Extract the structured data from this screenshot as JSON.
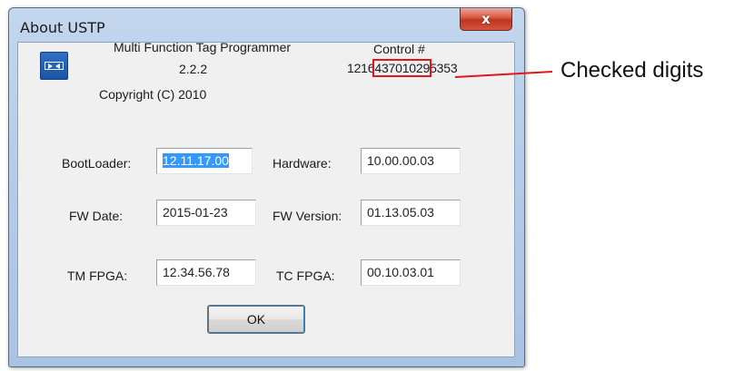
{
  "window": {
    "title": "About USTP",
    "close_glyph": "x"
  },
  "about": {
    "product_name": "Multi Function Tag Programmer",
    "version": "2.2.2",
    "copyright": "Copyright (C) 2010",
    "control_label": "Control #",
    "control_number_prefix": "1216",
    "control_number_checked": "43701029",
    "control_number_suffix": "5353"
  },
  "fields": {
    "bootloader": {
      "label": "BootLoader:",
      "value": "12.11.17.00"
    },
    "hardware": {
      "label": "Hardware:",
      "value": "10.00.00.03"
    },
    "fw_date": {
      "label": "FW Date:",
      "value": "2015-01-23"
    },
    "fw_version": {
      "label": "FW Version:",
      "value": "01.13.05.03"
    },
    "tm_fpga": {
      "label": "TM FPGA:",
      "value": "12.34.56.78"
    },
    "tc_fpga": {
      "label": "TC FPGA:",
      "value": "00.10.03.01"
    }
  },
  "buttons": {
    "ok_label": "OK"
  },
  "annotation": {
    "callout_text": "Checked digits",
    "callout_color": "#e0161b"
  },
  "icons": {
    "app_logo": "app-logo-icon",
    "close": "close-icon"
  },
  "colors": {
    "title_bar": "#b4cce8",
    "close_button": "#c0341f",
    "selection": "#3399ff",
    "dialog_face": "#f0f0f0"
  }
}
